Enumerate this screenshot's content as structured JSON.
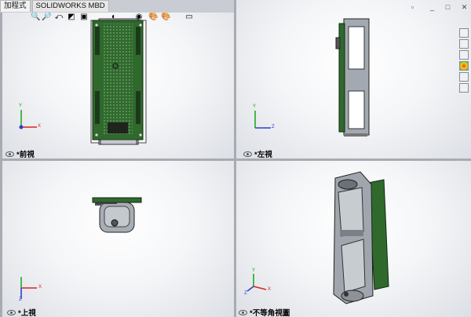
{
  "tabs": [
    {
      "label": "加程式"
    },
    {
      "label": "SOLIDWORKS MBD"
    }
  ],
  "views": {
    "front": "*前視",
    "left": "*左視",
    "top": "*上視",
    "iso": "*不等角視圖"
  },
  "axes": {
    "x": "X",
    "y": "Y",
    "z": "Z"
  },
  "toolbar_icons": [
    "zoom-fit-icon",
    "zoom-area-icon",
    "previous-view-icon",
    "section-view-icon",
    "view-orientation-icon",
    "display-style-icon",
    "hide-show-icon",
    "edit-appearance-icon",
    "apply-scene-icon",
    "view-settings-icon"
  ],
  "side_tabs": [
    "solidworks-resources-icon",
    "design-library-icon",
    "file-explorer-icon",
    "appearances-icon",
    "custom-properties-icon",
    "forum-icon"
  ],
  "colors": {
    "pcb": "#2f6a2c",
    "holder": "#9aa1a8",
    "accent": "#1a4fd8"
  }
}
